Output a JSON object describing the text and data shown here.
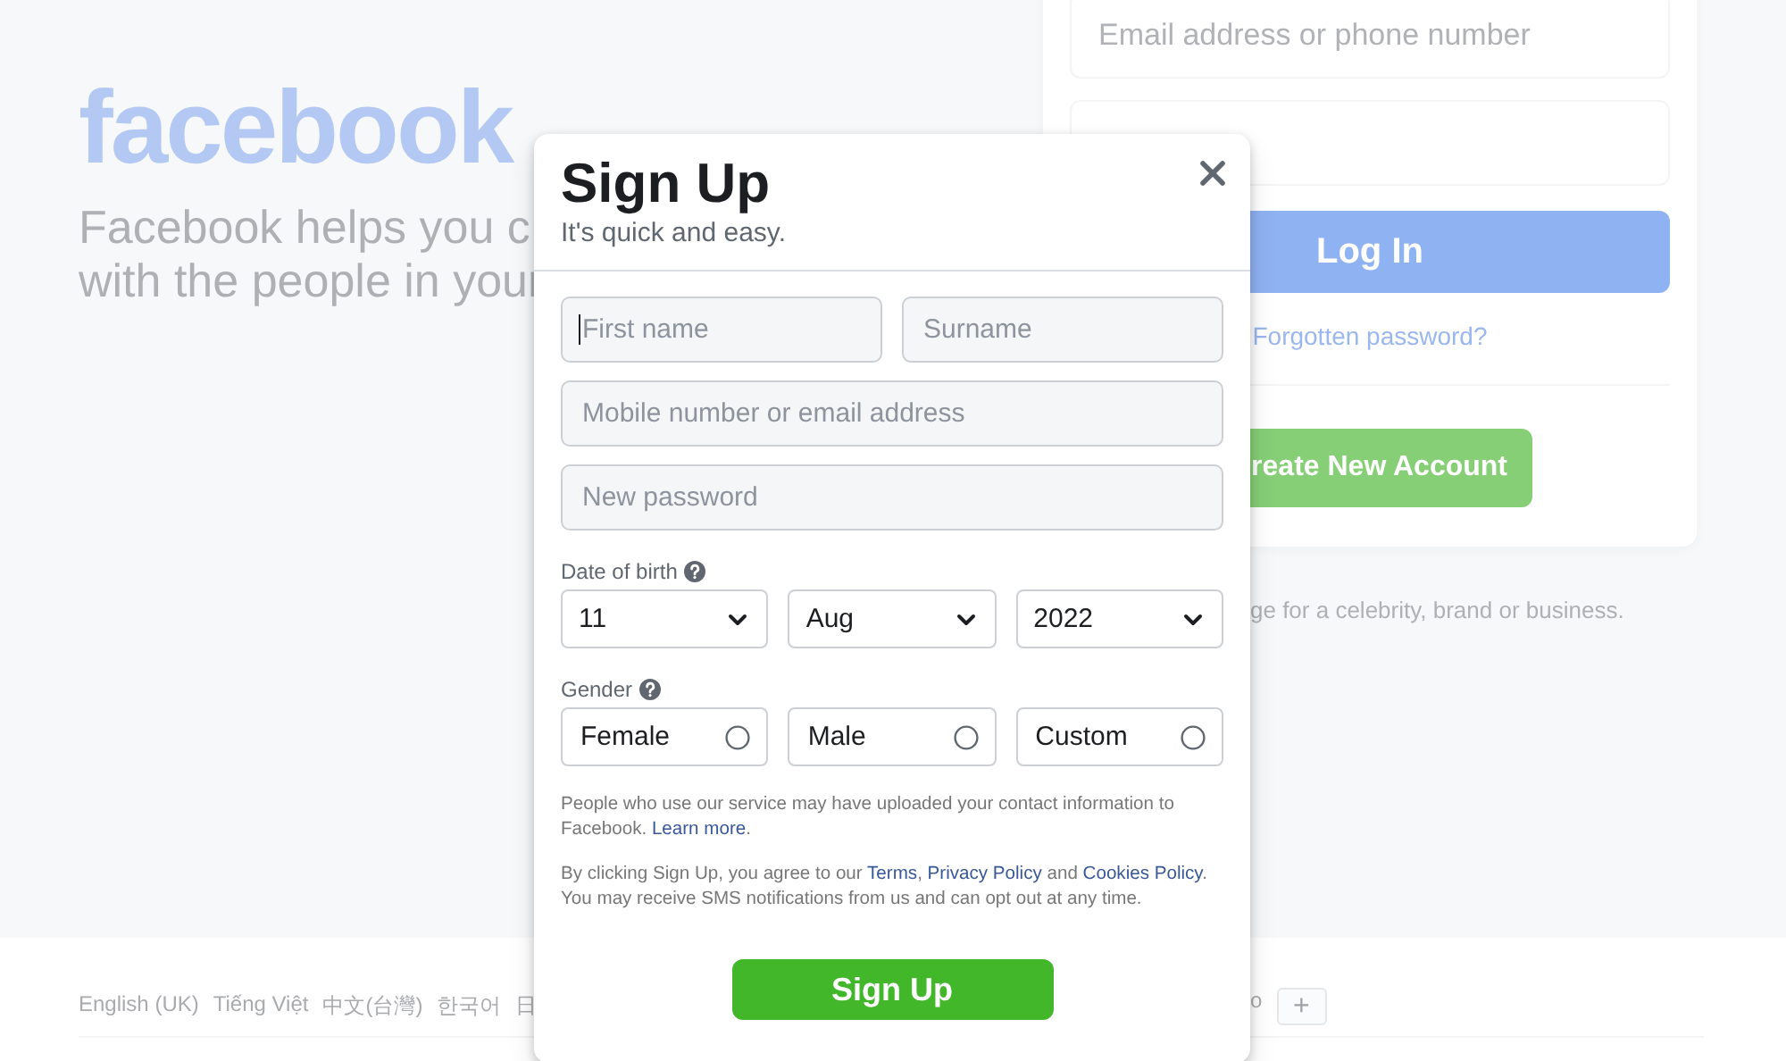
{
  "background": {
    "logo": "facebook",
    "tagline": [
      "Facebook helps you c",
      "with the people in your"
    ],
    "login": {
      "email_placeholder": "Email address or phone number",
      "login_button": "Log In",
      "forgot_link": "Forgotten password?",
      "create_button": "reate New Account"
    },
    "page_note": "ge for a celebrity, brand or business.",
    "languages_left": [
      "English (UK)",
      "Tiếng Việt",
      "中文(台灣)",
      "한국어",
      "日"
    ],
    "languages_right": [
      "o"
    ],
    "more_languages_button": "+"
  },
  "modal": {
    "title": "Sign Up",
    "subtitle": "It's quick and easy.",
    "name_fields": [
      {
        "placeholder": "First name",
        "focused": true
      },
      {
        "placeholder": "Surname",
        "focused": false
      }
    ],
    "fields": [
      {
        "placeholder": "Mobile number or email address",
        "focused": false
      },
      {
        "placeholder": "New password",
        "focused": false
      }
    ],
    "dob": {
      "label": "Date of birth",
      "selects": [
        {
          "value": "11"
        },
        {
          "value": "Aug"
        },
        {
          "value": "2022"
        }
      ]
    },
    "gender": {
      "label": "Gender",
      "options": [
        {
          "label": "Female",
          "selected": false
        },
        {
          "label": "Male",
          "selected": false
        },
        {
          "label": "Custom",
          "selected": false
        }
      ]
    },
    "contact_notice": [
      {
        "text": "People who use our service may have uploaded your contact information to Facebook. ",
        "link": false
      },
      {
        "text": "Learn more",
        "link": true
      },
      {
        "text": ".",
        "link": false
      }
    ],
    "terms": [
      {
        "text": "By clicking Sign Up, you agree to our ",
        "link": false
      },
      {
        "text": "Terms",
        "link": true
      },
      {
        "text": ", ",
        "link": false
      },
      {
        "text": "Privacy Policy",
        "link": true
      },
      {
        "text": " and ",
        "link": false
      },
      {
        "text": "Cookies Policy",
        "link": true
      },
      {
        "text": ". You may receive SMS notifications from us and can opt out at any time.",
        "link": false
      }
    ],
    "submit": "Sign Up"
  }
}
